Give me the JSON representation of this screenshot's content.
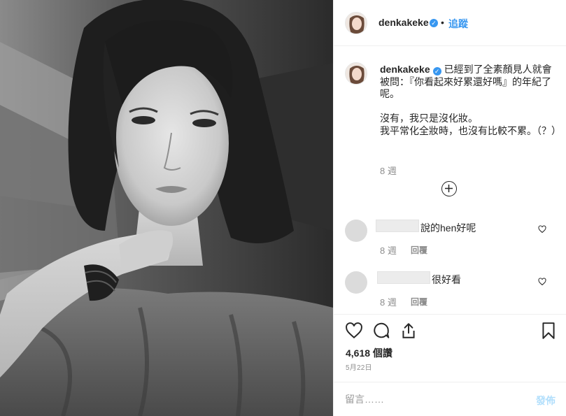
{
  "photo": {
    "alt_semantic": "black-and-white selfie photo"
  },
  "header": {
    "username": "denkakeke",
    "separator": "•",
    "follow_label": "追蹤"
  },
  "caption": {
    "username": "denkakeke",
    "text": "已經到了全素顏見人就會被問：『你看起來好累還好嗎』的年紀了呢。\n\n沒有，我只是沒化妝。\n我平常化全妝時，也沒有比較不累。（？）",
    "time": "8 週"
  },
  "comments": [
    {
      "text": "說的hen好呢",
      "time": "8 週",
      "reply_label": "回覆"
    },
    {
      "text": "很好看",
      "time": "8 週",
      "reply_label": "回覆"
    }
  ],
  "stats": {
    "views": "4,618 個讚",
    "date": "5月22日"
  },
  "comment_box": {
    "placeholder": "留言……",
    "post_label": "發佈"
  },
  "colors": {
    "accent": "#3897f0",
    "post_disabled": "#b2dffc",
    "muted": "#8e8e8e"
  },
  "icons": [
    "heart-icon",
    "comment-icon",
    "share-icon",
    "bookmark-icon",
    "plus-circle-icon",
    "verified-badge-icon"
  ]
}
